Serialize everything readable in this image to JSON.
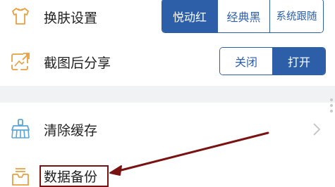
{
  "settings": {
    "theme": {
      "label": "换肤设置",
      "icon": "tshirt-icon",
      "options": [
        "悦动红",
        "经典黑",
        "系统跟随"
      ],
      "selected": "悦动红"
    },
    "share": {
      "label": "截图后分享",
      "icon": "share-image-icon",
      "options": [
        "关闭",
        "打开"
      ],
      "selected": "打开"
    },
    "cache": {
      "label": "清除缓存",
      "icon": "broom-icon"
    },
    "backup": {
      "label": "数据备份",
      "icon": "tray-icon"
    }
  },
  "colors": {
    "accent": "#2c5fa8",
    "annotation": "#7b1212",
    "icon_orange": "#e8a040"
  }
}
